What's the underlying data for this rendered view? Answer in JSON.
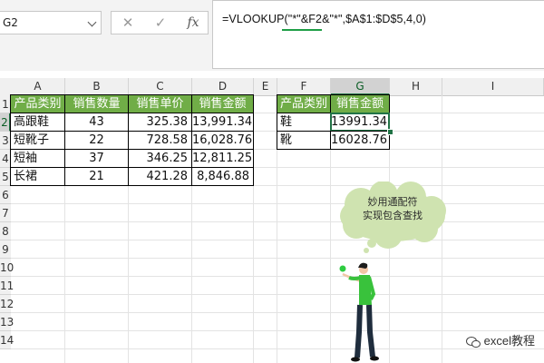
{
  "name_box": {
    "value": "G2"
  },
  "formula_bar": {
    "cancel_icon": "x-icon",
    "enter_icon": "check-icon",
    "fx_label": "fx",
    "formula": "=VLOOKUP(\"*\"&F2&\"*\",$A$1:$D$5,4,0)"
  },
  "columns": [
    "A",
    "B",
    "C",
    "D",
    "E",
    "F",
    "G",
    "H",
    "I"
  ],
  "rows": [
    "1",
    "2",
    "3",
    "4",
    "5",
    "6",
    "7",
    "8",
    "9",
    "10",
    "11",
    "12",
    "13",
    "14"
  ],
  "main_table": {
    "headers": [
      "产品类别",
      "销售数量",
      "销售单价",
      "销售金额"
    ],
    "rows": [
      [
        "高跟鞋",
        "43",
        "325.38",
        "13,991.34"
      ],
      [
        "短靴子",
        "22",
        "728.58",
        "16,028.76"
      ],
      [
        "短袖",
        "37",
        "346.25",
        "12,811.25"
      ],
      [
        "长裙",
        "21",
        "421.28",
        "8,846.88"
      ]
    ]
  },
  "lookup_table": {
    "headers": [
      "产品类别",
      "销售金额"
    ],
    "rows": [
      [
        "鞋",
        "13991.34"
      ],
      [
        "靴",
        "16028.76"
      ]
    ]
  },
  "callout": {
    "line1": "妙用通配符",
    "line2": "实现包含查找"
  },
  "watermark": {
    "text": "excel教程"
  },
  "colors": {
    "header_green": "#70ad47",
    "selection_green": "#217346",
    "cloud": "#cfe3b0"
  }
}
